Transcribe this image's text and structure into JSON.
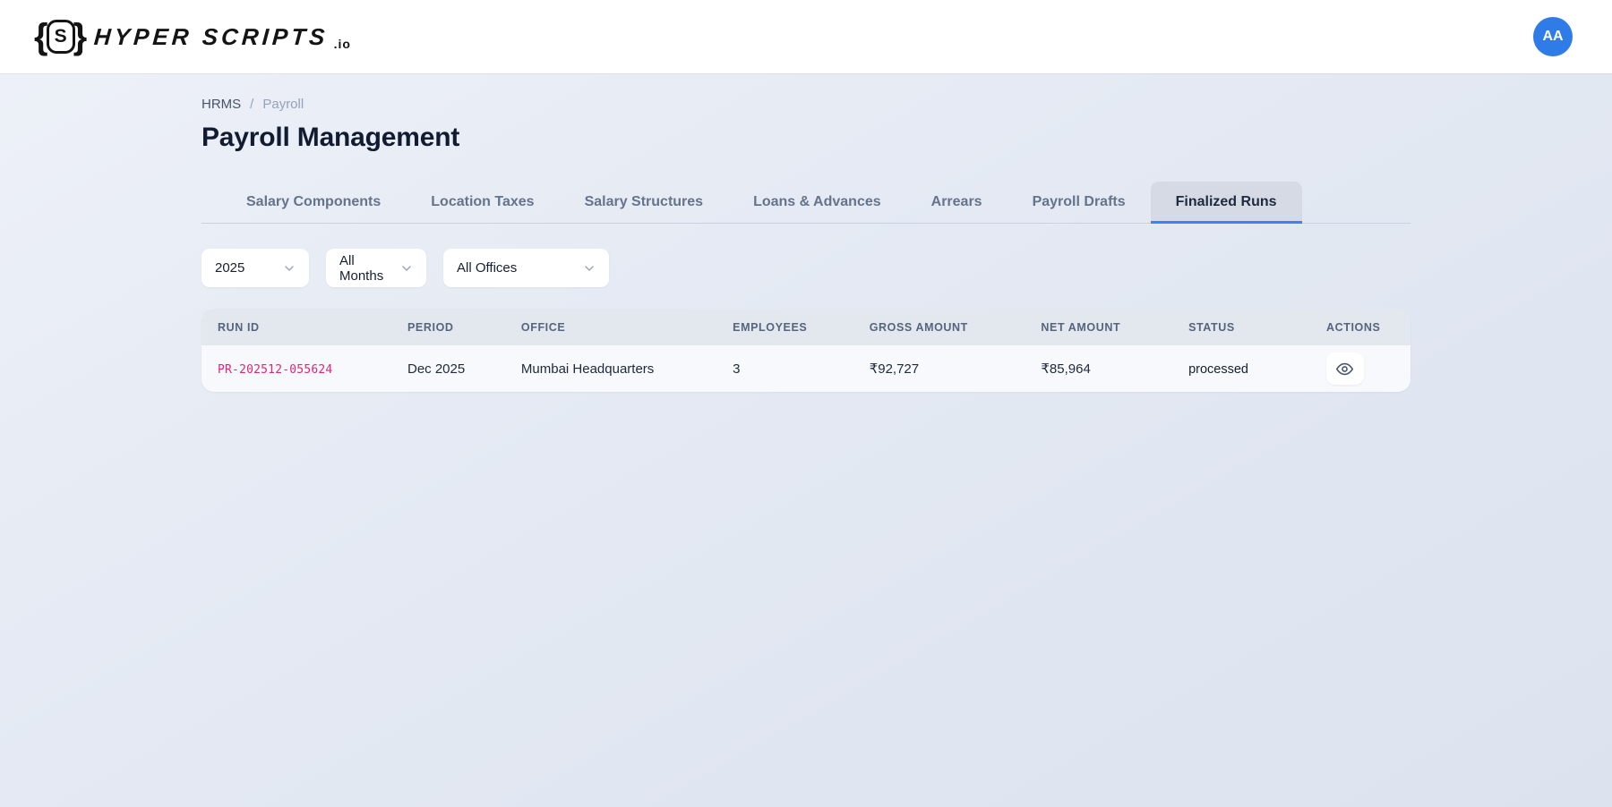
{
  "header": {
    "logo_text": "HYPER SCRIPTS",
    "logo_mark_letter": "S",
    "logo_brace_left": "{",
    "logo_brace_right": "}",
    "logo_suffix": ".io",
    "avatar_initials": "AA"
  },
  "breadcrumb": {
    "items": [
      "HRMS",
      "Payroll"
    ],
    "separator": "/"
  },
  "page": {
    "title": "Payroll Management"
  },
  "tabs": [
    {
      "label": "Salary Components",
      "active": false
    },
    {
      "label": "Location Taxes",
      "active": false
    },
    {
      "label": "Salary Structures",
      "active": false
    },
    {
      "label": "Loans & Advances",
      "active": false
    },
    {
      "label": "Arrears",
      "active": false
    },
    {
      "label": "Payroll Drafts",
      "active": false
    },
    {
      "label": "Finalized Runs",
      "active": true
    }
  ],
  "filters": {
    "year": "2025",
    "month": "All Months",
    "office": "All Offices"
  },
  "table": {
    "columns": [
      "Run ID",
      "Period",
      "Office",
      "Employees",
      "Gross Amount",
      "Net Amount",
      "Status",
      "Actions"
    ],
    "rows": [
      {
        "run_id": "PR-202512-055624",
        "period": "Dec 2025",
        "office": "Mumbai Headquarters",
        "employees": "3",
        "gross_amount": "₹92,727",
        "net_amount": "₹85,964",
        "status": "processed"
      }
    ]
  },
  "icons": {
    "actions_icon": "eye-icon",
    "select_icon": "chevron-down-icon"
  },
  "colors": {
    "accent": "#3b82f6",
    "run_id_text": "#db2777",
    "avatar_bg": "#2f7ce8",
    "active_tab_bg": "#d5dae5",
    "page_bg": "#e4e9f3",
    "topbar_bg": "#ffffff"
  }
}
